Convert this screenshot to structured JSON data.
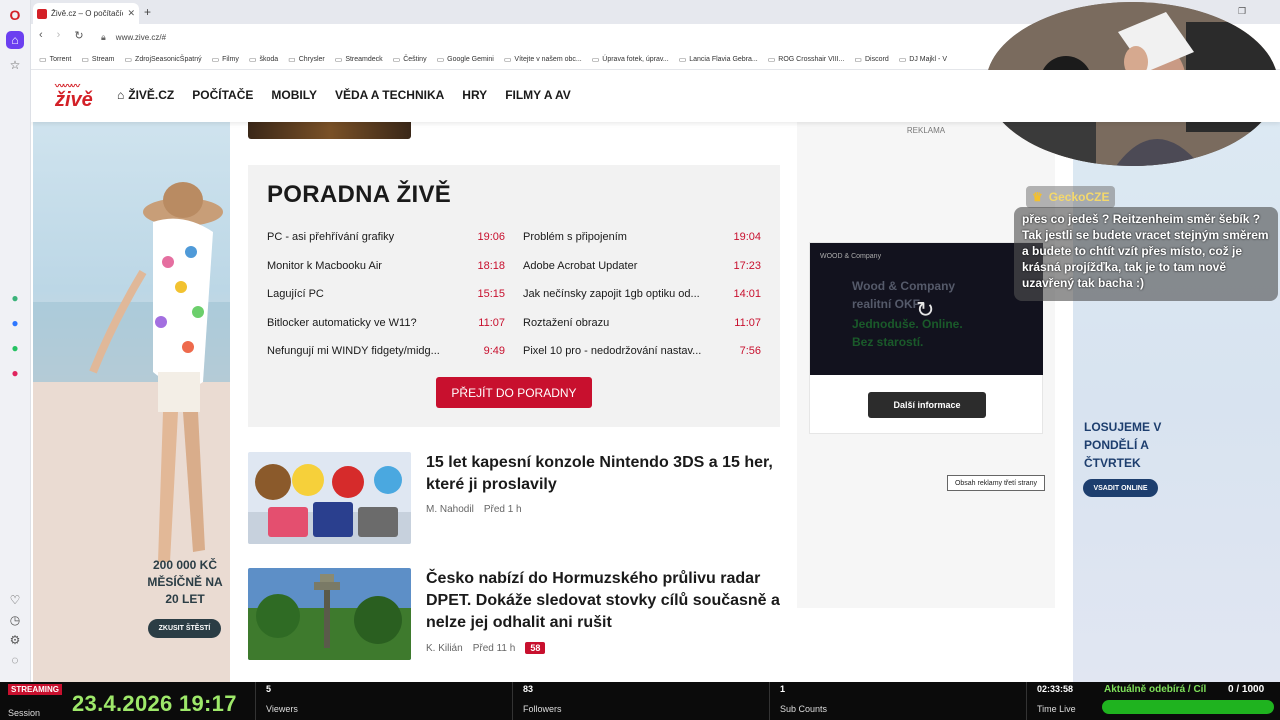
{
  "browser": {
    "tab_title": "Živě.cz – O počítačích, inte",
    "url": "www.zive.cz/#",
    "bookmarks": [
      "Torrent",
      "Stream",
      "ZdrojSeasonicŠpatný",
      "Filmy",
      "škoda",
      "Chrysler",
      "Streamdeck",
      "Češtiny",
      "Google Gemini",
      "Vítejte v našem obc...",
      "Úprava fotek, úprav...",
      "Lancia Flavia Gebra...",
      "ROG Crosshair VIII...",
      "Discord",
      "DJ Majkl - V"
    ]
  },
  "site": {
    "logo": "živě",
    "nav": [
      "ŽIVĚ.CZ",
      "POČÍTAČE",
      "MOBILY",
      "VĚDA A TECHNIKA",
      "HRY",
      "FILMY A AV"
    ]
  },
  "poradna": {
    "title": "PORADNA ŽIVĚ",
    "left": [
      {
        "q": "PC - asi přehřívání grafiky",
        "t": "19:06"
      },
      {
        "q": "Monitor k Macbooku Air",
        "t": "18:18"
      },
      {
        "q": "Lagující PC",
        "t": "15:15"
      },
      {
        "q": "Bitlocker automaticky ve W11?",
        "t": "11:07"
      },
      {
        "q": "Nefungují mi WINDY fidgety/midg...",
        "t": "9:49"
      }
    ],
    "right": [
      {
        "q": "Problém s připojením",
        "t": "19:04"
      },
      {
        "q": "Adobe Acrobat Updater",
        "t": "17:23"
      },
      {
        "q": "Jak nečínsky zapojit 1gb optiku od...",
        "t": "14:01"
      },
      {
        "q": "Roztažení obrazu",
        "t": "11:07"
      },
      {
        "q": "Pixel 10 pro - nedodržování nastav...",
        "t": "7:56"
      }
    ],
    "button": "PŘEJÍT DO PORADNY"
  },
  "articles": [
    {
      "title": "15 let kapesní konzole Nintendo 3DS a 15 her, které ji proslavily",
      "author": "M. Nahodil",
      "time": "Před 1 h",
      "comments": ""
    },
    {
      "title": "Česko nabízí do Hormuzského průlivu radar DPET. Dokáže sledovat stovky cílů současně a nelze jej odhalit ani rušit",
      "author": "K. Kilián",
      "time": "Před 11 h",
      "comments": "58"
    }
  ],
  "ad": {
    "label": "REKLAMA",
    "brand": "WOOD & Company",
    "line1": "Wood & Company",
    "line2": "realitní OKF",
    "line3": "Jednoduše. Online.",
    "line4": "Bez starostí.",
    "button": "Další informace",
    "tooltip": "Obsah reklamy třetí strany"
  },
  "left_ad": {
    "text": "200 000 KČ MĚSÍČNĚ NA 20 LET",
    "button": "ZKUSIT ŠTĚSTÍ"
  },
  "right_ad": {
    "text": "LOSUJEME V PONDĚLÍ A ČTVRTEK",
    "button": "VSADIT ONLINE"
  },
  "chat": {
    "user": "GeckoCZE",
    "message": "přes co jedeš ? Reitzenheim směr šebík ? Tak jestli se budete vracet stejným směrem a budete to chtít vzít přes místo, což je krásná projížďka, tak je to tam nově uzavřený tak bacha :)"
  },
  "stream": {
    "badge": "STREAMING",
    "session_label": "Session",
    "datetime": "23.4.2026 19:17",
    "viewers": {
      "value": "5",
      "label": "Viewers"
    },
    "followers": {
      "value": "83",
      "label": "Followers"
    },
    "subs": {
      "value": "1",
      "label": "Sub Counts"
    },
    "time_live": {
      "value": "02:33:58",
      "label": "Time Live"
    },
    "goal_label": "Aktuálně odebírá / Cíl",
    "goal_count": "0 / 1000",
    "goal_progress": 0
  },
  "colors": {
    "brand_red": "#c8102e",
    "stream_green": "#9ee86a"
  }
}
